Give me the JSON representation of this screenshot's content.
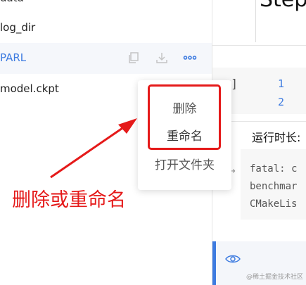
{
  "files": [
    {
      "name": "data"
    },
    {
      "name": "log_dir"
    },
    {
      "name": "PARL"
    },
    {
      "name": "model.ckpt"
    }
  ],
  "row_actions": {
    "icons": [
      "copy-icon",
      "download-icon",
      "more-icon"
    ],
    "more_glyph": "•••"
  },
  "context_menu": {
    "items": [
      "删除",
      "重命名",
      "打开文件夹"
    ]
  },
  "annotation": {
    "text": "删除或重命名",
    "color": "#e51a1a"
  },
  "right_pane": {
    "title": "Step",
    "bracket": "]",
    "line_numbers": [
      "1",
      "2"
    ],
    "runtime_label": "运行时长:",
    "log_arrow": "→",
    "log_lines": [
      "fatal: c",
      "benchmar",
      "CMakeLis"
    ]
  },
  "watermark": "@稀土掘金技术社区",
  "colors": {
    "accent": "#3d7be0",
    "highlight": "#e51a1a"
  }
}
